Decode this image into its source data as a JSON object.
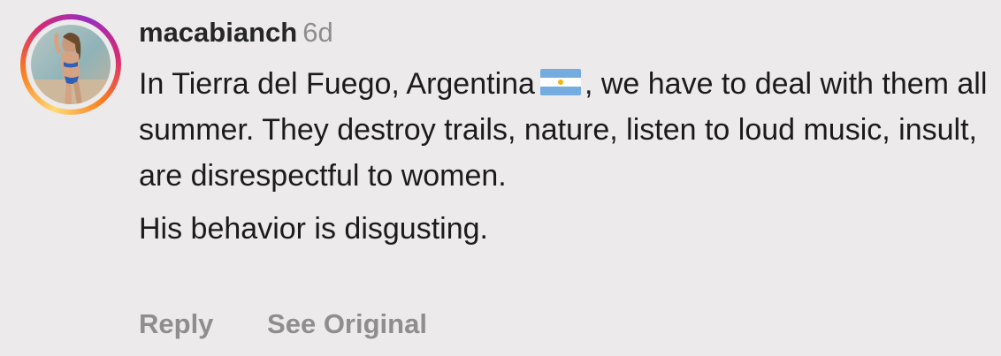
{
  "comment": {
    "username": "macabianch",
    "time_ago": "6d",
    "text_line1_before_flag": "In Tierra del Fuego, Argentina",
    "flag_icon": "argentina-flag-icon",
    "text_line1_after_flag": ", we have to deal with them all summer. They destroy trails, nature, listen to loud music, insult, are disrespectful to women.",
    "text_paragraph2": "His behavior is disgusting."
  },
  "actions": {
    "reply_label": "Reply",
    "see_original_label": "See Original"
  },
  "colors": {
    "background": "#eceaea",
    "username": "#262626",
    "secondary_text": "#8e8e8e",
    "body_text": "#1b1b1b",
    "story_ring_gradient": [
      "#feda75",
      "#fa7e1e",
      "#d62976",
      "#962fbf"
    ],
    "flag_blue": "#74acdf",
    "flag_sun": "#f6b40e"
  }
}
